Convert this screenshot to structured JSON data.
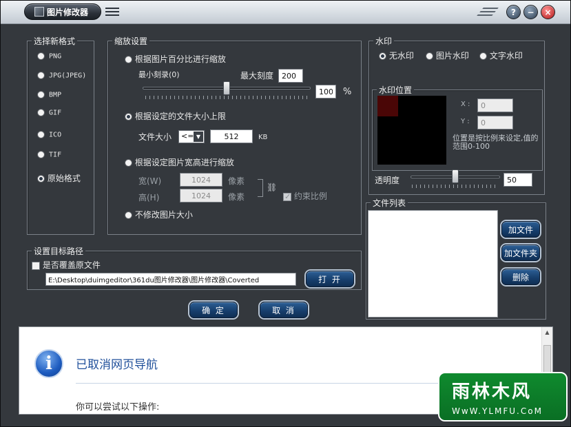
{
  "window": {
    "title": "图片修改器"
  },
  "format_panel": {
    "title": "选择新格式",
    "options": [
      {
        "label": "PNG",
        "selected": false
      },
      {
        "label": "JPG(JPEG)",
        "selected": false
      },
      {
        "label": "BMP",
        "selected": false
      },
      {
        "label": "GIF",
        "selected": false
      },
      {
        "label": "ICO",
        "selected": false
      },
      {
        "label": "TIF",
        "selected": false
      },
      {
        "label": "原始格式",
        "selected": true
      }
    ]
  },
  "scale_panel": {
    "title": "缩放设置",
    "opt_percent": "根据图片百分比进行缩放",
    "min_scale": "最小刻录(0)",
    "max_scale_label": "最大刻度",
    "max_scale_value": "200",
    "percent_value": "100",
    "percent_unit": "%",
    "slider_level": 0.5,
    "opt_filesize": "根据设定的文件大小上限",
    "filesize_label": "文件大小",
    "filesize_op": "<=",
    "filesize_value": "512",
    "filesize_unit": "KB",
    "opt_dimension": "根据设定图片宽高进行缩放",
    "width_label": "宽(W)",
    "width_value": "1024",
    "width_unit": "像素",
    "height_label": "高(H)",
    "height_value": "1024",
    "height_unit": "像素",
    "keep_ratio": "约束比例",
    "opt_nochange": "不修改图片大小",
    "selected_option": "filesize"
  },
  "watermark_panel": {
    "title": "水印",
    "opt_none": "无水印",
    "opt_image": "图片水印",
    "opt_text": "文字水印",
    "position_title": "水印位置",
    "x_label": "X :",
    "x_value": "0",
    "y_label": "Y :",
    "y_value": "0",
    "position_hint": "位置是按比例来设定,值的范围0-100",
    "opacity_label": "透明度",
    "opacity_value": "50",
    "opacity_level": 0.5
  },
  "file_list_panel": {
    "title": "文件列表",
    "add_file": "加文件",
    "add_folder": "加文件夹",
    "delete": "删除"
  },
  "target_panel": {
    "title": "设置目标路径",
    "overwrite": "是否覆盖原文件",
    "path": "E:\\Desktop\\duimgeditor\\361du图片修改器\\图片修改器\\Coverted",
    "open_button": "打 开"
  },
  "actions": {
    "ok": "确 定",
    "cancel": "取 消"
  },
  "browser": {
    "heading": "已取消网页导航",
    "subtext": "你可以尝试以下操作:"
  },
  "site_watermark": {
    "name": "雨林木风",
    "url": "WwW.YLMFU.CoM"
  },
  "colors": {
    "window_bg": "#34383d",
    "button_blue": "#173f6d",
    "heading_blue": "#1f4f9a",
    "logo_green": "#0f8a2e"
  }
}
